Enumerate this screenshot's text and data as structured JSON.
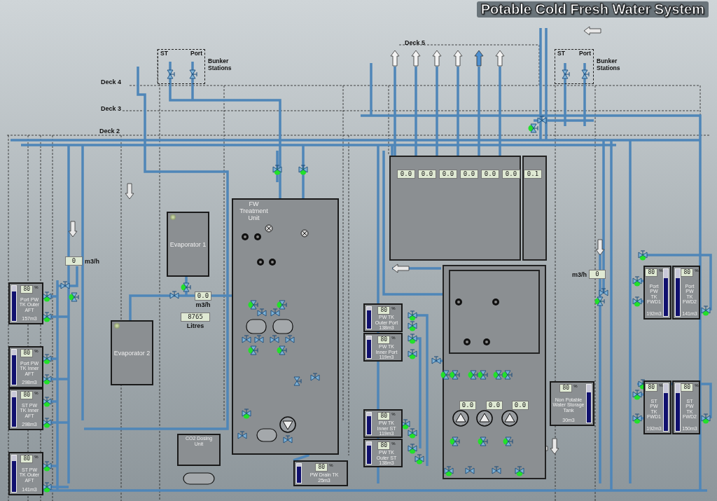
{
  "title": "Potable Cold Fresh Water System",
  "decks": [
    {
      "label": "Deck 5"
    },
    {
      "label": "Deck 4"
    },
    {
      "label": "Deck 3"
    },
    {
      "label": "Deck 2"
    }
  ],
  "bunker_stations": [
    {
      "label": "Bunker Stations",
      "sides": [
        "ST",
        "Port"
      ]
    },
    {
      "label": "Bunker Stations",
      "sides": [
        "ST",
        "Port"
      ]
    }
  ],
  "units": [
    {
      "kind": "evaporator",
      "label": "Evaporator 1"
    },
    {
      "kind": "evaporator",
      "label": "Evaporator 2"
    },
    {
      "kind": "treatment",
      "label": "FW Treatment Unit"
    },
    {
      "kind": "dosing",
      "label": "CO2 Dosing Unit"
    }
  ],
  "readouts": [
    {
      "value": "0",
      "label": "m3/h"
    },
    {
      "value": "0.0",
      "label": "m3/h"
    },
    {
      "value": "8765",
      "label": "Litres"
    },
    {
      "value": "0",
      "label": "m3/h"
    }
  ],
  "distribution_flows": [
    "0.0",
    "0.0",
    "0.0",
    "0.0",
    "0.0",
    "0.0",
    "0.1"
  ],
  "pump_flows": [
    "0.0",
    "0.0",
    "0.0"
  ],
  "tanks": [
    {
      "name": "Port PW TK Outer AFT",
      "volume": "157m3",
      "percent": "80",
      "unit": "%",
      "level": 0.85
    },
    {
      "name": "Port PW TK Inner AFT",
      "volume": "298m3",
      "percent": "80",
      "unit": "%",
      "level": 0.85
    },
    {
      "name": "ST PW TK Inner AFT",
      "volume": "298m3",
      "percent": "80",
      "unit": "%",
      "level": 0.85
    },
    {
      "name": "ST PW TK Outer AFT",
      "volume": "141m3",
      "percent": "80",
      "unit": "%",
      "level": 0.85
    },
    {
      "name": "PW TK Outer Port",
      "volume": "138m3",
      "percent": "80",
      "unit": "%",
      "level": 0.85
    },
    {
      "name": "PW TK Inner Port",
      "volume": "119m3",
      "percent": "80",
      "unit": "%",
      "level": 0.85
    },
    {
      "name": "PW TK Inner ST",
      "volume": "119m3",
      "percent": "80",
      "unit": "%",
      "level": 0.85
    },
    {
      "name": "PW TK Outer ST",
      "volume": "138m3",
      "percent": "80",
      "unit": "%",
      "level": 0.85
    },
    {
      "name": "PW Drain TK",
      "volume": "25m3",
      "percent": "80",
      "unit": "%",
      "level": 0.85
    },
    {
      "name": "Non Potable Water Storage Tank",
      "volume": "30m3",
      "percent": "80",
      "unit": "%",
      "level": 0.8
    },
    {
      "name": "Port PW TK FWD1",
      "volume": "192m3",
      "percent": "80",
      "unit": "%",
      "level": 0.8
    },
    {
      "name": "Port PW TK FWD2",
      "volume": "141m3",
      "percent": "80",
      "unit": "%",
      "level": 0.8
    },
    {
      "name": "ST PW TK FWD1",
      "volume": "192m3",
      "percent": "80",
      "unit": "%",
      "level": 0.8
    },
    {
      "name": "ST PW TK FWD2",
      "volume": "150m3",
      "percent": "80",
      "unit": "%",
      "level": 0.8
    }
  ],
  "valves": [
    {
      "open": true
    },
    {
      "open": true
    },
    {
      "open": false
    },
    {
      "open": true
    },
    {
      "open": true
    },
    {
      "open": true
    },
    {
      "open": true
    },
    {
      "open": true
    },
    {
      "open": true
    },
    {
      "open": true
    },
    {
      "open": true
    },
    {
      "open": false
    },
    {
      "open": false
    },
    {
      "open": false
    },
    {
      "open": false
    },
    {
      "open": false
    },
    {
      "open": true
    },
    {
      "open": false
    },
    {
      "open": true
    },
    {
      "open": true
    },
    {
      "open": true
    },
    {
      "open": true
    },
    {
      "open": false
    },
    {
      "open": false
    },
    {
      "open": false
    },
    {
      "open": false
    },
    {
      "open": false
    },
    {
      "open": false
    },
    {
      "open": true
    },
    {
      "open": true
    },
    {
      "open": false
    },
    {
      "open": false
    },
    {
      "open": true
    },
    {
      "open": false
    },
    {
      "open": false
    },
    {
      "open": true
    },
    {
      "open": true
    },
    {
      "open": true
    },
    {
      "open": true
    },
    {
      "open": true
    },
    {
      "open": true
    },
    {
      "open": true
    },
    {
      "open": true
    },
    {
      "open": true
    },
    {
      "open": false
    },
    {
      "open": true
    },
    {
      "open": true
    },
    {
      "open": true
    },
    {
      "open": true
    },
    {
      "open": true
    },
    {
      "open": true
    },
    {
      "open": true
    },
    {
      "open": true
    },
    {
      "open": true
    },
    {
      "open": true
    },
    {
      "open": true
    },
    {
      "open": true
    },
    {
      "open": true
    },
    {
      "open": true
    },
    {
      "open": true
    },
    {
      "open": true
    },
    {
      "open": true
    },
    {
      "open": true
    },
    {
      "open": true
    },
    {
      "open": false
    },
    {
      "open": false
    },
    {
      "open": false
    }
  ]
}
